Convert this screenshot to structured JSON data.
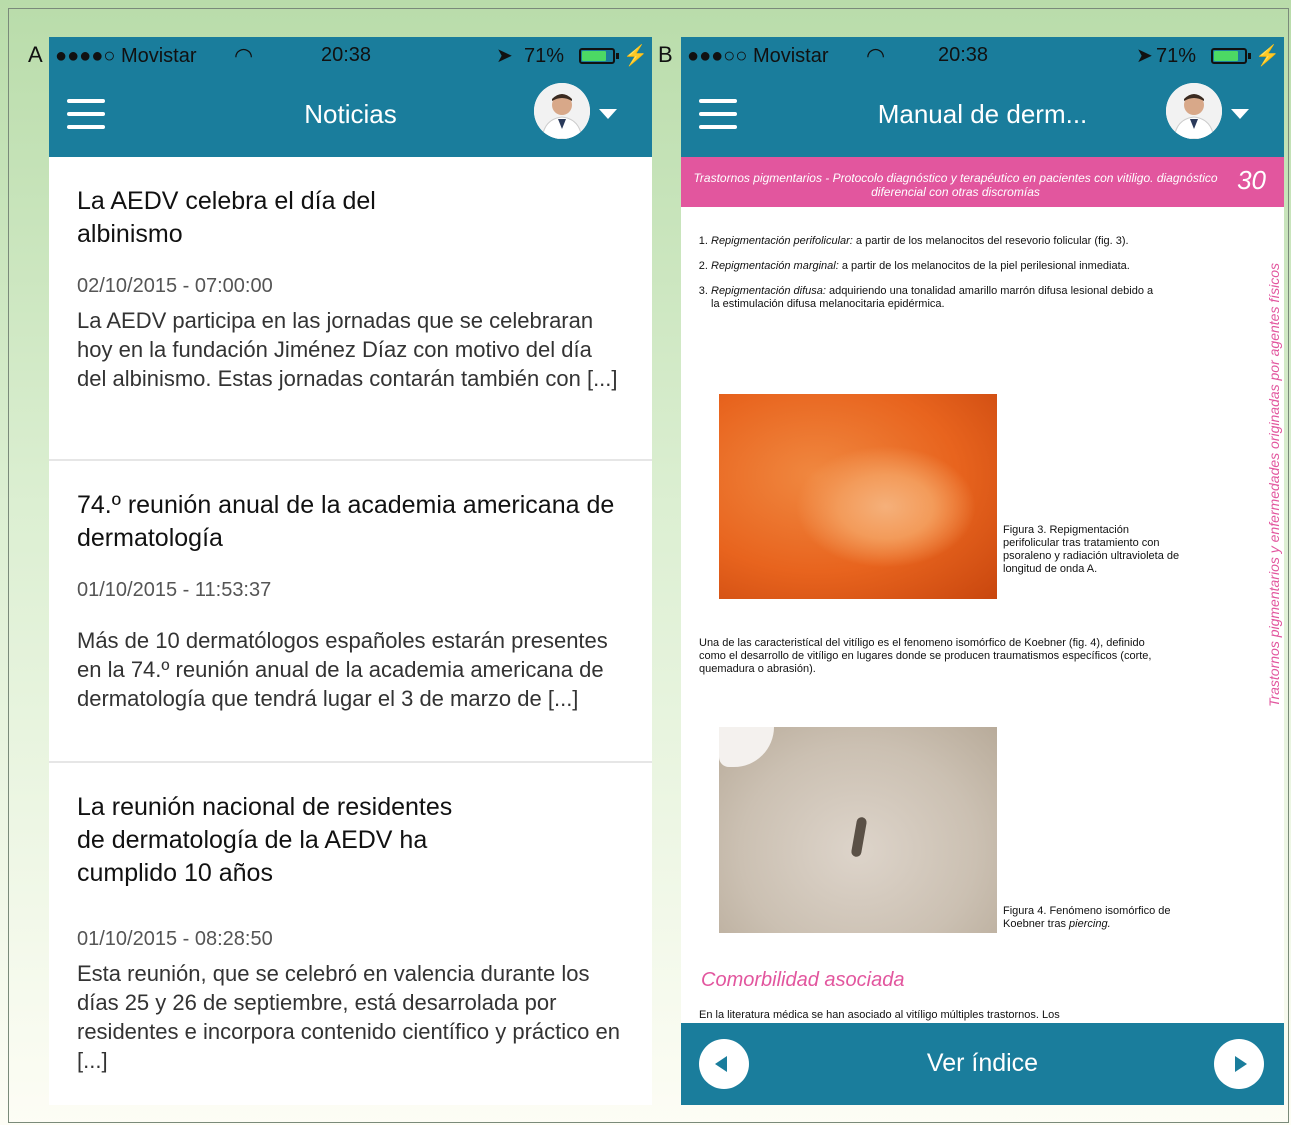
{
  "panels": {
    "a": "A",
    "b": "B"
  },
  "status": {
    "a": {
      "carrier": "●●●●○ Movistar",
      "time": "20:38",
      "battery": "71%"
    },
    "b": {
      "carrier": "●●●○○ Movistar",
      "time": "20:38",
      "battery": "71%"
    }
  },
  "news": {
    "title": "Noticias",
    "items": [
      {
        "title": "La AEDV celebra el día del albinismo",
        "date": "02/10/2015 - 07:00:00",
        "body": "La AEDV participa en las jornadas que se celebraran hoy en la fundación Jiménez Díaz con motivo del día del albinismo. Estas jornadas contarán también con [...]"
      },
      {
        "title": "74.º reunión anual de la academia americana de dermatología",
        "date": "01/10/2015 - 11:53:37",
        "body": "Más de 10 dermatólogos españoles estarán presentes en la 74.º reunión anual de la academia americana de dermatología que tendrá lugar el 3 de marzo de [...]"
      },
      {
        "title": "La reunión nacional de residentes de dermatología de la AEDV ha cumplido 10 años",
        "date": "01/10/2015 - 08:28:50",
        "body": "Esta reunión, que se celebró en valencia durante los días 25 y 26 de septiembre, está desarrolada por residentes e incorpora contenido científico y práctico en [...]"
      }
    ]
  },
  "manual": {
    "title": "Manual de derm...",
    "header": "Trastornos pigmentarios - Protocolo diagnóstico y terapéutico en pacientes con vitiligo. diagnóstico diferencial con otras discromías",
    "page": "30",
    "side": "Trastornos pigmentarios y enfermedades originadas por agentes físicos",
    "list": [
      {
        "term": "Repigmentación perifolicular:",
        "text": " a partir de los melanocitos del resevorio folicular (fig. 3)."
      },
      {
        "term": "Repigmentación marginal:",
        "text": " a partir de los melanocitos de la piel perilesional inmediata."
      },
      {
        "term": "Repigmentación difusa:",
        "text": " adquiriendo una tonalidad amarillo marrón difusa lesional debido a la estimulación difusa melanocitaria epidérmica."
      }
    ],
    "fig3": "Figura 3. Repigmentación perifolicular tras tratamiento con psoraleno y radiación ultravioleta de longitud de onda A.",
    "para": "Una de las caracteristícal del vitíligo es el fenomeno isomórfico de Koebner (fig. 4), definido como el desarrollo de vitíligo en lugares donde se producen traumatismos específicos (corte, quemadura o abrasión).",
    "fig4": "Figura 4. Fenómeno isomórfico de Koebner tras",
    "fig4_italic": "piercing.",
    "heading": "Comorbilidad asociada",
    "para2": "En la literatura médica se han asociado al vitíligo múltiples trastornos. Los",
    "bottom": "Ver índice"
  }
}
